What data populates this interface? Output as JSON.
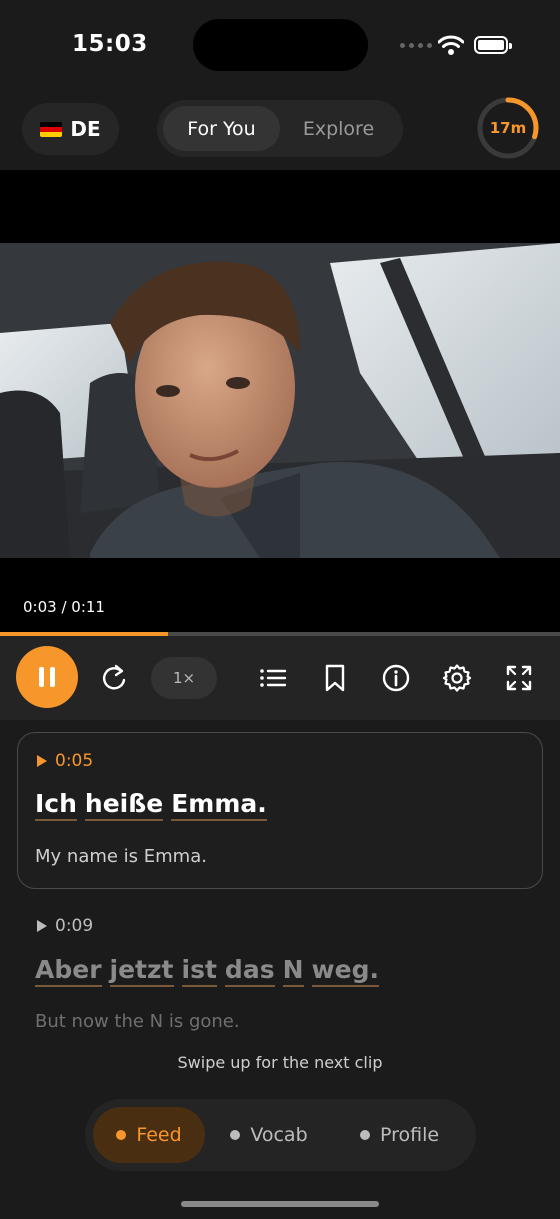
{
  "status_bar": {
    "time": "15:03"
  },
  "header": {
    "language": "DE",
    "flag": "germany-flag",
    "tabs": [
      {
        "label": "For You",
        "active": true
      },
      {
        "label": "Explore",
        "active": false
      }
    ],
    "timer": {
      "label": "17m",
      "progress": 0.3
    }
  },
  "video": {
    "time_display": "0:03 / 0:11",
    "progress": 0.3
  },
  "controls": {
    "speed": "1×",
    "icons": [
      "pause-icon",
      "replay-icon",
      "list-icon",
      "bookmark-icon",
      "info-icon",
      "settings-icon",
      "fullscreen-icon"
    ]
  },
  "subtitles": [
    {
      "timestamp": "0:05",
      "words": [
        "Ich",
        "heiße",
        "Emma."
      ],
      "translation": "My name is Emma.",
      "active": true
    },
    {
      "timestamp": "0:09",
      "words": [
        "Aber",
        "jetzt",
        "ist",
        "das",
        "N",
        "weg."
      ],
      "translation": "But now the N is gone.",
      "active": false
    }
  ],
  "hint": "Swipe up for the next clip",
  "nav": [
    {
      "label": "Feed",
      "active": true
    },
    {
      "label": "Vocab",
      "active": false
    },
    {
      "label": "Profile",
      "active": false
    }
  ],
  "colors": {
    "accent": "#f7962a",
    "background": "#1b1b1b",
    "surface": "#242424"
  }
}
